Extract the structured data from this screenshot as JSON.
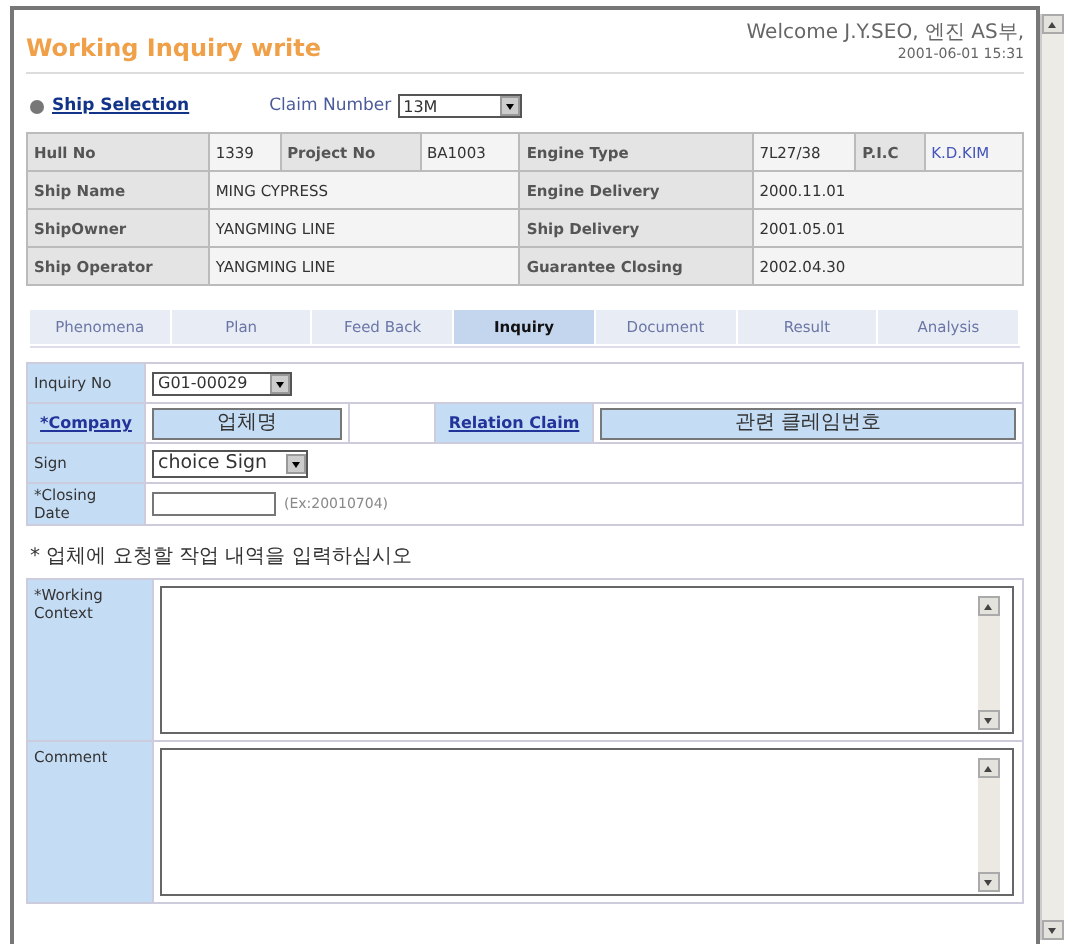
{
  "header": {
    "title": "Working Inquiry write",
    "welcome": "Welcome J.Y.SEO, 엔진 AS부,",
    "datetime": "2001-06-01  15:31"
  },
  "ship_selection": {
    "link": "Ship Selection",
    "claim_label": "Claim Number",
    "claim_value": "13M"
  },
  "info_table": [
    [
      {
        "kind": "label",
        "text": "Hull No"
      },
      {
        "kind": "value",
        "text": "1339"
      },
      {
        "kind": "label",
        "text": "Project No"
      },
      {
        "kind": "value",
        "text": "BA1003"
      },
      {
        "kind": "label",
        "text": "Engine Type"
      },
      {
        "kind": "value",
        "text": "7L27/38"
      },
      {
        "kind": "label",
        "text": "P.I.C"
      },
      {
        "kind": "link",
        "text": "K.D.KIM"
      }
    ],
    [
      {
        "kind": "label",
        "text": "Ship Name"
      },
      {
        "kind": "value",
        "text": "MING CYPRESS"
      },
      {
        "kind": "label",
        "text": "Engine Delivery"
      },
      {
        "kind": "value",
        "text": "2000.11.01"
      }
    ],
    [
      {
        "kind": "label",
        "text": "ShipOwner"
      },
      {
        "kind": "value",
        "text": "YANGMING LINE"
      },
      {
        "kind": "label",
        "text": "Ship Delivery"
      },
      {
        "kind": "value",
        "text": "2001.05.01"
      }
    ],
    [
      {
        "kind": "label",
        "text": "Ship Operator"
      },
      {
        "kind": "value",
        "text": "YANGMING LINE"
      },
      {
        "kind": "label",
        "text": "Guarantee Closing"
      },
      {
        "kind": "value",
        "text": "2002.04.30"
      }
    ]
  ],
  "tabs": [
    {
      "label": "Phenomena",
      "selected": false
    },
    {
      "label": "Plan",
      "selected": false
    },
    {
      "label": "Feed Back",
      "selected": false
    },
    {
      "label": "Inquiry",
      "selected": true
    },
    {
      "label": "Document",
      "selected": false
    },
    {
      "label": "Result",
      "selected": false
    },
    {
      "label": "Analysis",
      "selected": false
    }
  ],
  "inquiry_form": {
    "inquiry_no": {
      "label": "Inquiry No",
      "value": "G01-00029"
    },
    "company": {
      "label": "*Company",
      "value": "업체명"
    },
    "relation_claim": {
      "label": "Relation Claim",
      "value": "관련 클레임번호"
    },
    "sign": {
      "label": "Sign",
      "value": "choice Sign"
    },
    "closing_date": {
      "label": "*Closing Date",
      "hint": "(Ex:20010704)"
    }
  },
  "note": "* 업체에 요청할 작업 내역을 입력하십시오",
  "text_areas": [
    {
      "label": "*Working Context"
    },
    {
      "label": "Comment"
    }
  ]
}
